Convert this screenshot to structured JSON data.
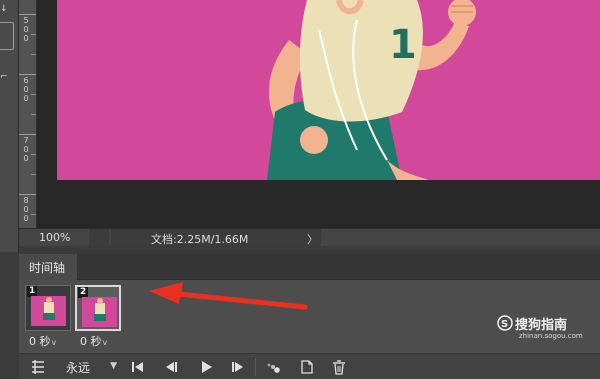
{
  "ruler": {
    "labels": [
      "5 0 0",
      "6 0 0",
      "7 0 0",
      "8 0 0"
    ]
  },
  "status": {
    "zoom": "100%",
    "doc_info": "文档:2.25M/1.66M",
    "arrow": "〉"
  },
  "timeline": {
    "tab_label": "时间轴",
    "frames": [
      {
        "number": "1",
        "delay": "0 秒",
        "selected": false
      },
      {
        "number": "2",
        "delay": "0 秒",
        "selected": true
      }
    ],
    "loop": {
      "value": "永远"
    },
    "delay_chevron": "v"
  },
  "artwork": {
    "jersey_number": "1",
    "background_color": "#d2489a"
  },
  "annotation": {
    "arrow_color": "#e8321f"
  },
  "watermark": {
    "title": "搜狗指南",
    "url": "zhinan.sogou.com"
  },
  "icons": {
    "tween": "tween-icon",
    "first": "first-frame-icon",
    "prev": "previous-frame-icon",
    "play": "play-icon",
    "next": "next-frame-icon",
    "tween_frames": "tween-frames-icon",
    "duplicate": "duplicate-frame-icon",
    "delete": "trash-icon"
  }
}
